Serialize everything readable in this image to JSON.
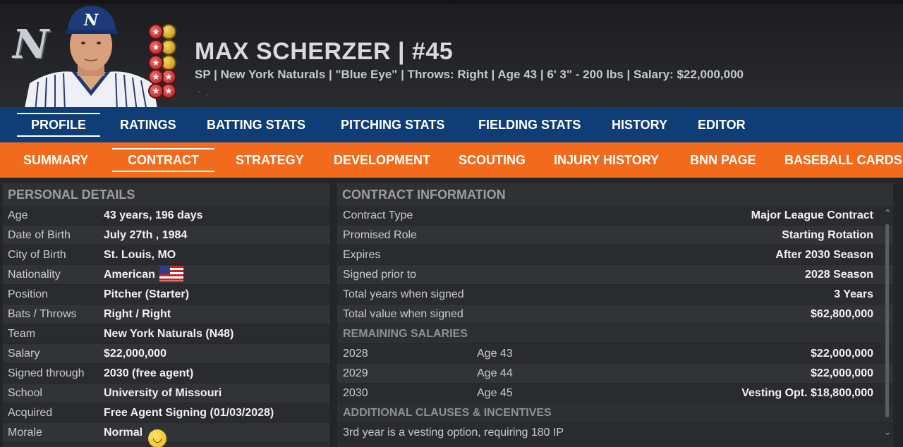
{
  "header": {
    "team_logo": "N",
    "name": "MAX SCHERZER  |  #45",
    "info": "SP | New York Naturals  |  \"Blue Eye\" | Throws: Right  |  Age 43  |  6' 3\"  - 200 lbs  |  Salary: $22,000,000"
  },
  "main_tabs": [
    "PROFILE",
    "RATINGS",
    "BATTING STATS",
    "PITCHING STATS",
    "FIELDING STATS",
    "HISTORY",
    "EDITOR"
  ],
  "sub_tabs": [
    "SUMMARY",
    "CONTRACT",
    "STRATEGY",
    "DEVELOPMENT",
    "SCOUTING",
    "INJURY HISTORY",
    "BNN PAGE",
    "BASEBALL CARDS"
  ],
  "personal": {
    "title": "PERSONAL DETAILS",
    "rows": [
      {
        "label": "Age",
        "value": "43 years, 196 days"
      },
      {
        "label": "Date of Birth",
        "value": "July 27th , 1984"
      },
      {
        "label": "City of Birth",
        "value": "St. Louis, MO"
      },
      {
        "label": "Nationality",
        "value": "American"
      },
      {
        "label": "Position",
        "value": "Pitcher (Starter)"
      },
      {
        "label": "Bats / Throws",
        "value": "Right / Right"
      },
      {
        "label": "Team",
        "value": "New York Naturals (N48)"
      },
      {
        "label": "Salary",
        "value": "$22,000,000"
      },
      {
        "label": "Signed through",
        "value": "2030 (free agent)"
      },
      {
        "label": "School",
        "value": "University of Missouri"
      },
      {
        "label": "Acquired",
        "value": "Free Agent Signing (01/03/2028)"
      },
      {
        "label": "Morale",
        "value": "Normal"
      }
    ]
  },
  "contract": {
    "title": "CONTRACT INFORMATION",
    "rows": [
      {
        "label": "Contract Type",
        "value": "Major League Contract"
      },
      {
        "label": "Promised Role",
        "value": "Starting Rotation"
      },
      {
        "label": "Expires",
        "value": "After 2030 Season"
      },
      {
        "label": "Signed prior to",
        "value": "2028 Season"
      },
      {
        "label": "Total years when signed",
        "value": "3 Years"
      },
      {
        "label": "Total value when signed",
        "value": "$62,800,000"
      }
    ],
    "remaining_title": "REMAINING SALARIES",
    "remaining": [
      {
        "year": "2028",
        "age": "Age 43",
        "value": "$22,000,000"
      },
      {
        "year": "2029",
        "age": "Age 44",
        "value": "$22,000,000"
      },
      {
        "year": "2030",
        "age": "Age 45",
        "value": "Vesting Opt. $18,800,000"
      }
    ],
    "clauses_title": "ADDITIONAL CLAUSES & INCENTIVES",
    "clause": "3rd year is a vesting option, requiring 180 IP"
  }
}
